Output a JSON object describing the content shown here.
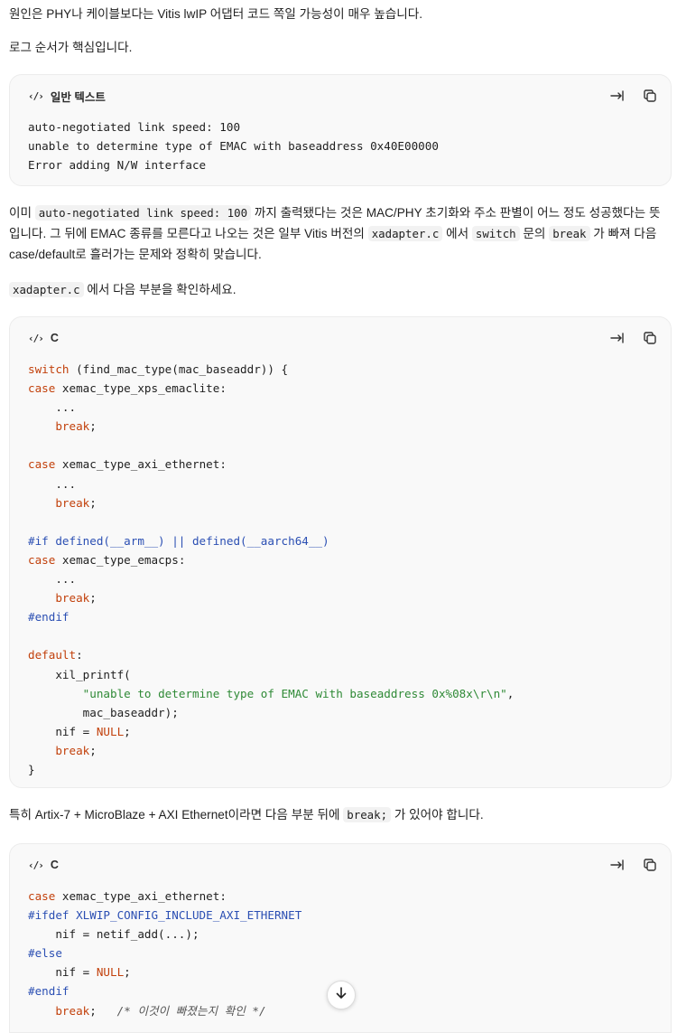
{
  "para1": "원인은 PHY나 케이블보다는 Vitis lwIP 어댑터 코드 쪽일 가능성이 매우 높습니다.",
  "para2": "로그 순서가 핵심입니다.",
  "block1": {
    "lang": "일반 텍스트",
    "lines": [
      "auto-negotiated link speed: 100",
      "unable to determine type of EMAC with baseaddress 0x40E00000",
      "Error adding N/W interface"
    ]
  },
  "para3": {
    "t1": "이미 ",
    "c1": "auto-negotiated link speed: 100",
    "t2": " 까지 출력됐다는 것은 MAC/PHY 초기화와 주소 판별이 어느 정도 성공했다는 뜻입니다. 그 뒤에 EMAC 종류를 모른다고 나오는 것은 일부 Vitis 버전의 ",
    "c2": "xadapter.c",
    "t3": " 에서 ",
    "c3": "switch",
    "t4": " 문의 ",
    "c4": "break",
    "t5": " 가 빠져 다음 case/default로 흘러가는 문제와 정확히 맞습니다."
  },
  "para4": {
    "c1": "xadapter.c",
    "t1": " 에서 다음 부분을 확인하세요."
  },
  "block2": {
    "lang": "C",
    "l01a": "switch",
    "l01b": " (find_mac_type(mac_baseaddr)) {",
    "l02a": "case",
    "l02b": " xemac_type_xps_emaclite:",
    "l03": "    ...",
    "l04a": "    ",
    "l04b": "break",
    "l04c": ";",
    "l06a": "case",
    "l06b": " xemac_type_axi_ethernet:",
    "l07": "    ...",
    "l08b": "break",
    "l10a": "#if defined(__arm__) || defined(__aarch64__)",
    "l11a": "case",
    "l11b": " xemac_type_emacps:",
    "l12": "    ...",
    "l13b": "break",
    "l14": "#endif",
    "l16a": "default",
    "l16b": ":",
    "l17": "    xil_printf(",
    "l18": "\"unable to determine type of EMAC with baseaddress 0x%08x\\r\\n\"",
    "l18b": ",",
    "l19": "        mac_baseaddr);",
    "l20a": "    nif = ",
    "l20b": "NULL",
    "l20c": ";",
    "l21b": "break",
    "l22": "}"
  },
  "para5": {
    "t1": "특히 Artix-7 + MicroBlaze + AXI Ethernet이라면 다음 부분 뒤에 ",
    "c1": "break;",
    "t2": " 가 있어야 합니다."
  },
  "block3": {
    "lang": "C",
    "l1a": "case",
    "l1b": " xemac_type_axi_ethernet:",
    "l2a": "#ifdef",
    "l2b": " XLWIP_CONFIG_INCLUDE_AXI_ETHERNET",
    "l3": "    nif = netif_add(...);",
    "l4": "#else",
    "l5b": "NULL",
    "l6": "#endif",
    "l7b": "break",
    "l7c": ";",
    "l7d": "/* 이것이 빠졌는지 확인 */"
  },
  "colors": {
    "keyword": "#c2410c",
    "preprocessor": "#2b4fb3",
    "string": "#2f8a36",
    "block_bg": "#f9f9f9"
  },
  "icons": {
    "lang": "code-icon",
    "wrap": "wrap-lines-icon",
    "copy": "copy-icon",
    "scroll": "arrow-down-icon"
  }
}
